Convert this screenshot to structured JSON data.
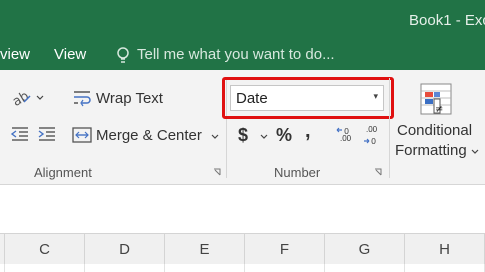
{
  "window": {
    "title": "Book1 - Exc"
  },
  "tabs": [
    {
      "label": "view"
    },
    {
      "label": "View"
    }
  ],
  "tell_me": {
    "placeholder": "Tell me what you want to do..."
  },
  "ribbon": {
    "alignment": {
      "wrap_text": "Wrap Text",
      "merge_center": "Merge & Center",
      "group_label": "Alignment"
    },
    "number": {
      "format_value": "Date",
      "currency": "$",
      "percent": "%",
      "comma": ",",
      "increase_decimal": ".00",
      "decrease_decimal": ".00",
      "group_label": "Number"
    },
    "styles": {
      "conditional_line1": "Conditional",
      "conditional_line2": "Formatting"
    }
  },
  "columns": [
    "C",
    "D",
    "E",
    "F",
    "G",
    "H"
  ],
  "colors": {
    "accent": "#217346",
    "highlight": "#e01010"
  }
}
